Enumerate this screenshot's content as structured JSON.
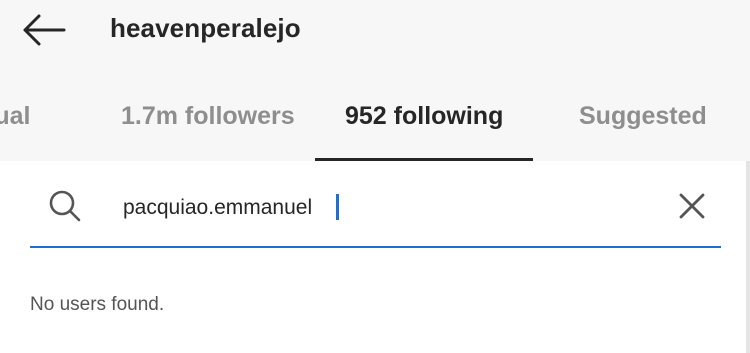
{
  "header": {
    "username": "heavenperalejo",
    "back_icon": "arrow-left-icon"
  },
  "tabs": [
    {
      "label": "tual",
      "active": false
    },
    {
      "label": "1.7m followers",
      "active": false
    },
    {
      "label": "952 following",
      "active": true
    },
    {
      "label": "Suggested",
      "active": false
    }
  ],
  "search": {
    "value": "pacquiao.emmanuel",
    "icon": "search-icon",
    "clear_icon": "close-icon",
    "accent_color": "#1f6ed4"
  },
  "results": {
    "empty_message": "No users found."
  }
}
